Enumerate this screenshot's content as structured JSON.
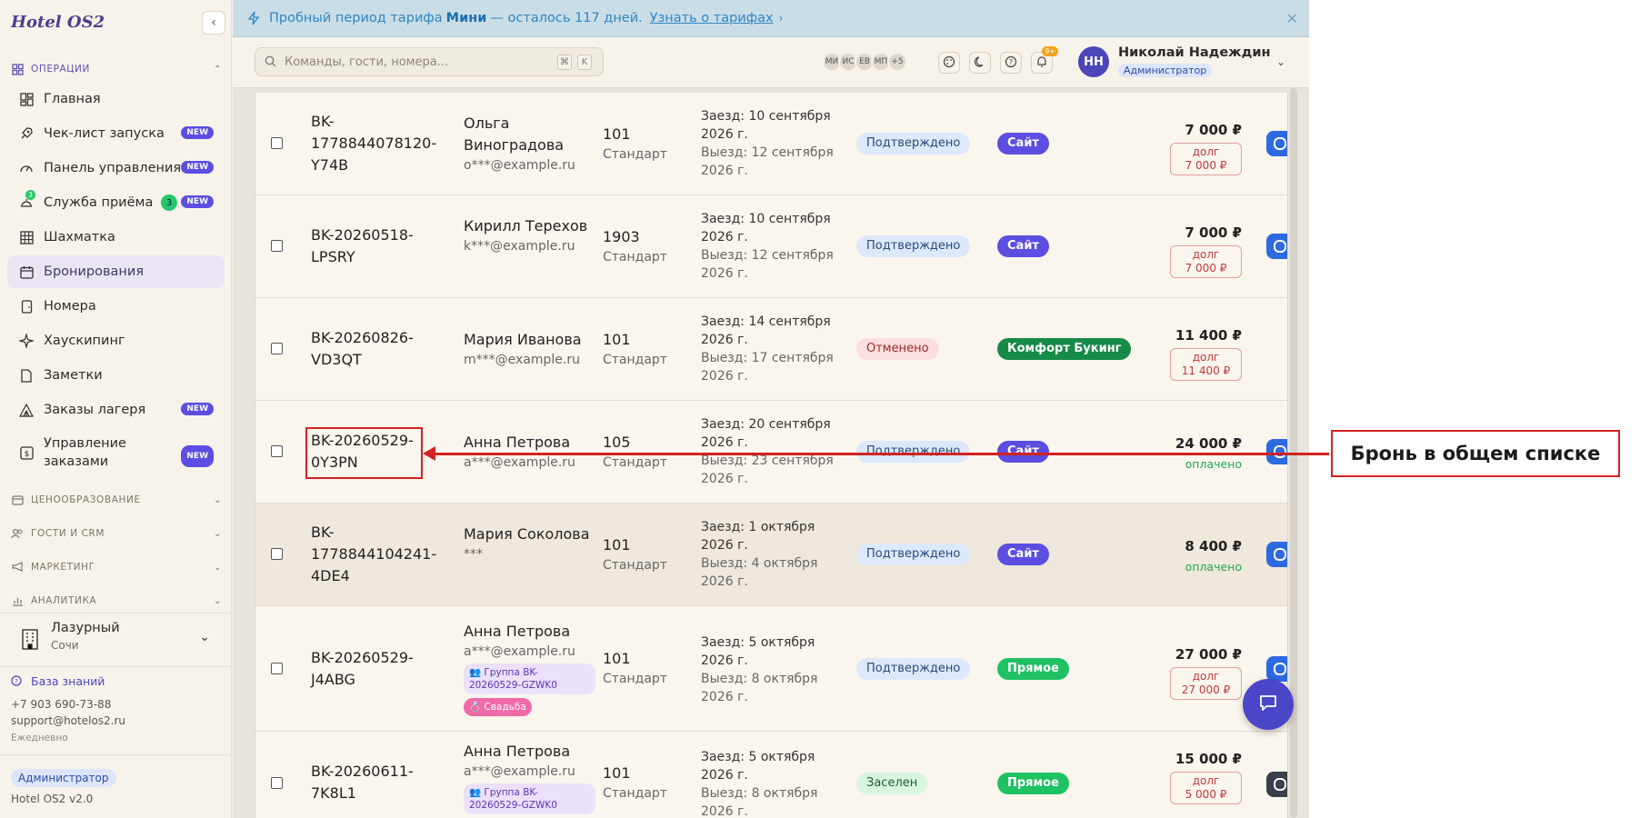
{
  "sidebar": {
    "brand": "Hotel OS2",
    "operations_label": "ОПЕРАЦИИ",
    "items": [
      {
        "label": "Главная"
      },
      {
        "label": "Чек-лист запуска",
        "badge": "NEW"
      },
      {
        "label": "Панель управления",
        "badge": "NEW"
      },
      {
        "label": "Служба приёма",
        "count": "3",
        "mini": "3",
        "badge": "NEW"
      },
      {
        "label": "Шахматка"
      },
      {
        "label": "Бронирования"
      },
      {
        "label": "Номера"
      },
      {
        "label": "Хаускипинг"
      },
      {
        "label": "Заметки"
      },
      {
        "label": "Заказы лагеря",
        "badge": "NEW"
      },
      {
        "label": "Управление заказами",
        "badge": "NEW"
      }
    ],
    "sections": [
      "ЦЕНООБРАЗОВАНИЕ",
      "ГОСТИ И CRM",
      "МАРКЕТИНГ",
      "АНАЛИТИКА"
    ],
    "hotel_name": "Лазурный",
    "hotel_city": "Сочи",
    "kb_label": "База знаний",
    "phone": "+7 903 690-73-88",
    "email": "support@hotelos2.ru",
    "hours": "Ежедневно",
    "role": "Администратор",
    "version": "Hotel OS2 v2.0"
  },
  "trial": {
    "prefix": "Пробный период тарифа",
    "plan": "Мини",
    "suffix": "— осталось 117 дней.",
    "link": "Узнать о тарифах"
  },
  "topbar": {
    "search_placeholder": "Команды, гости, номера...",
    "kbd1": "⌘",
    "kbd2": "K",
    "avatars": [
      "МИ",
      "ИС",
      "ЕВ",
      "МП",
      "+5"
    ],
    "notif_count": "9+",
    "user_initials": "НН",
    "user_name": "Николай Надеждин",
    "user_role": "Администратор"
  },
  "rows": [
    {
      "id": "BK-1778844078120-Y74B",
      "guest": "Ольга Виноградова",
      "email": "o***@example.ru",
      "room": "101",
      "room_type": "Стандарт",
      "checkin": "Заезд: 10 сентября 2026 г.",
      "checkout": "Выезд: 12 сентября 2026 г.",
      "status": "Подтверждено",
      "source": "Сайт",
      "amount": "7 000 ₽",
      "debt_label": "долг",
      "debt": "7 000 ₽"
    },
    {
      "id": "BK-20260518-LPSRY",
      "guest": "Кирилл Терехов",
      "email": "k***@example.ru",
      "room": "1903",
      "room_type": "Стандарт",
      "checkin": "Заезд: 10 сентября 2026 г.",
      "checkout": "Выезд: 12 сентября 2026 г.",
      "status": "Подтверждено",
      "source": "Сайт",
      "amount": "7 000 ₽",
      "debt_label": "долг",
      "debt": "7 000 ₽"
    },
    {
      "id": "BK-20260826-VD3QT",
      "guest": "Мария Иванова",
      "email": "m***@example.ru",
      "room": "101",
      "room_type": "Стандарт",
      "checkin": "Заезд: 14 сентября 2026 г.",
      "checkout": "Выезд: 17 сентября 2026 г.",
      "status": "Отменено",
      "source": "Комфорт Букинг",
      "amount": "11 400 ₽",
      "debt_label": "долг",
      "debt": "11 400 ₽"
    },
    {
      "id": "BK-20260529-0Y3PN",
      "guest": "Анна Петрова",
      "email": "a***@example.ru",
      "room": "105",
      "room_type": "Стандарт",
      "checkin": "Заезд: 20 сентября 2026 г.",
      "checkout": "Выезд: 23 сентября 2026 г.",
      "status": "Подтверждено",
      "source": "Сайт",
      "amount": "24 000 ₽",
      "paid": "оплачено"
    },
    {
      "id": "BK-1778844104241-4DE4",
      "guest": "Мария Соколова",
      "email": "***",
      "room": "101",
      "room_type": "Стандарт",
      "checkin": "Заезд: 1 октября 2026 г.",
      "checkout": "Выезд: 4 октября 2026 г.",
      "status": "Подтверждено",
      "source": "Сайт",
      "amount": "8 400 ₽",
      "paid": "оплачено"
    },
    {
      "id": "BK-20260529-J4ABG",
      "guest": "Анна Петрова",
      "email": "a***@example.ru",
      "group_tag": "👥 Группа BK-20260529-GZWK0",
      "event_tag": "💍 Свадьба",
      "room": "101",
      "room_type": "Стандарт",
      "checkin": "Заезд: 5 октября 2026 г.",
      "checkout": "Выезд: 8 октября 2026 г.",
      "status": "Подтверждено",
      "source": "Прямое",
      "amount": "27 000 ₽",
      "debt_label": "долг",
      "debt": "27 000 ₽"
    },
    {
      "id": "BK-20260611-7K8L1",
      "guest": "Анна Петрова",
      "email": "a***@example.ru",
      "group_tag": "👥 Группа BK-20260529-GZWK0",
      "room": "101",
      "room_type": "Стандарт",
      "checkin": "Заезд: 5 октября 2026 г.",
      "checkout": "Выезд: 8 октября 2026 г.",
      "status": "Заселен",
      "source": "Прямое",
      "amount": "15 000 ₽",
      "debt_label": "долг",
      "debt": "5 000 ₽"
    }
  ],
  "annotation": {
    "callout": "Бронь в общем списке"
  }
}
